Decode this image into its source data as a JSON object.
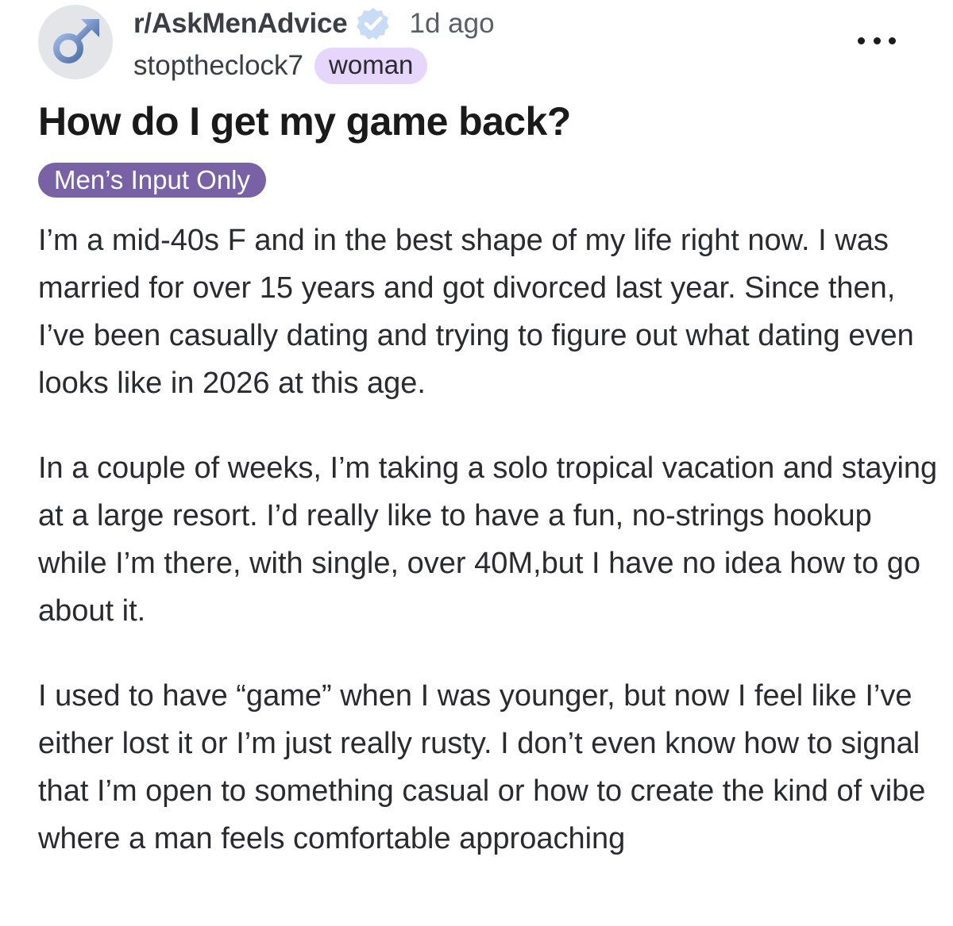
{
  "post": {
    "subreddit": "r/AskMenAdvice",
    "time_ago": "1d ago",
    "author": "stoptheclock7",
    "author_flair": "woman",
    "title": "How do I get my game back?",
    "post_flair": "Men’s Input Only",
    "paragraphs": [
      "I’m a mid-40s F and in the best shape of my life right now. I was married for over 15 years and got divorced last year. Since then, I’ve been casually dating and trying to figure out what dating even looks like in 2026 at this age.",
      "In a couple of weeks, I’m taking a solo tropical vacation and staying at a large resort. I’d really like to have a fun, no-strings hookup while I’m there, with single, over 40M,but I have no idea how to go about it.",
      "I used to have “game” when I was younger, but now I feel like I’ve either lost it or I’m just really rusty. I don’t even know how to signal that I’m open to something casual or how to create the kind of vibe where a man feels comfortable approaching"
    ]
  },
  "icons": {
    "avatar": "male-symbol-icon",
    "verified": "verified-badge-icon",
    "more": "more-options-icon"
  },
  "colors": {
    "author_flair_bg": "#e6d6fb",
    "post_flair_bg": "#7862a5",
    "verified_badge": "#c9dcf6",
    "avatar_symbol": "#6b8cc4"
  }
}
